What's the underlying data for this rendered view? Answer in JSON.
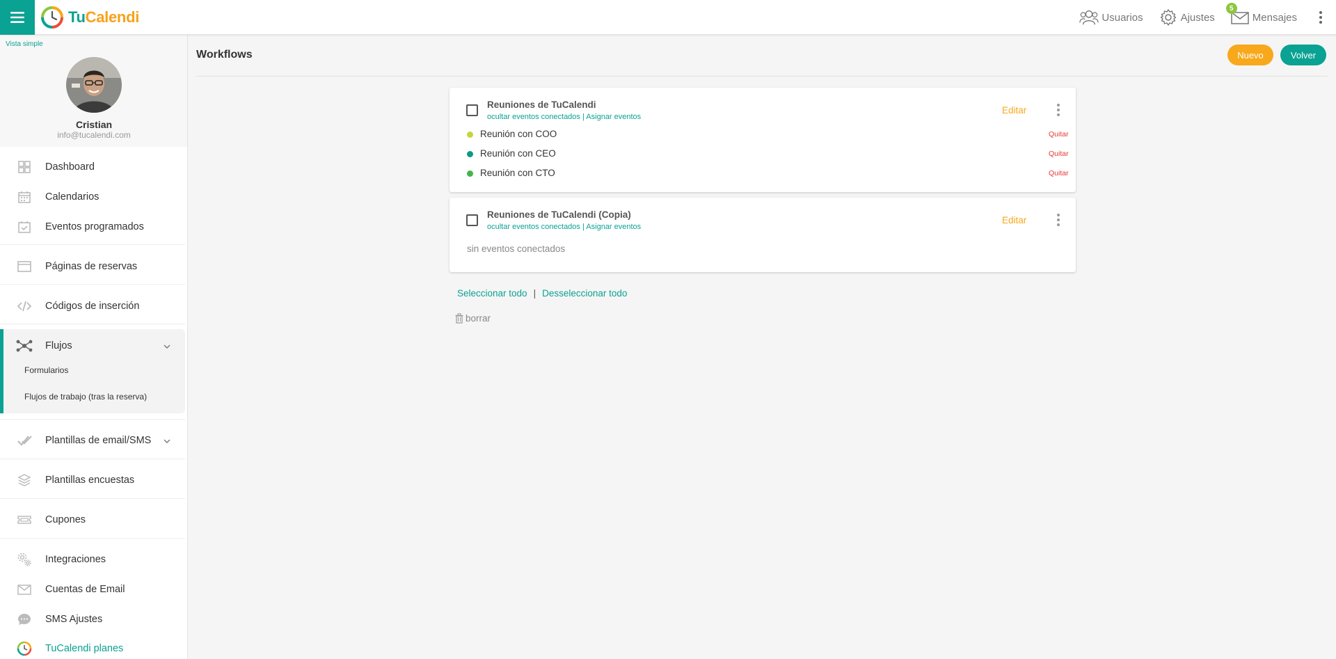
{
  "topbar": {
    "logo_tu": "Tu",
    "logo_cal": "Calendi",
    "usuarios": "Usuarios",
    "ajustes": "Ajustes",
    "mensajes": "Mensajes",
    "mensajes_badge": "5"
  },
  "sidebar": {
    "vista": "Vista simple",
    "profile": {
      "name": "Cristian",
      "email": "info@tucalendi.com"
    },
    "items": {
      "dashboard": "Dashboard",
      "calendarios": "Calendarios",
      "eventos": "Eventos programados",
      "paginas": "Páginas de reservas",
      "codigos": "Códigos de inserción",
      "flujos": "Flujos",
      "formularios": "Formularios",
      "flujos_trabajo": "Flujos de trabajo (tras la reserva)",
      "plantillas_email": "Plantillas de email/SMS",
      "plantillas_encuestas": "Plantillas encuestas",
      "cupones": "Cupones",
      "integraciones": "Integraciones",
      "cuentas_email": "Cuentas de Email",
      "sms_ajustes": "SMS Ajustes",
      "planes": "TuCalendi planes"
    }
  },
  "main": {
    "title": "Workflows",
    "btn_nuevo": "Nuevo",
    "btn_volver": "Volver",
    "workflows": [
      {
        "title": "Reuniones de TuCalendi",
        "link_hide": "ocultar eventos conectados",
        "link_sep": "|",
        "link_assign": "Asignar eventos",
        "edit": "Editar",
        "events": [
          {
            "name": "Reunión con COO",
            "color": "#c6d63a",
            "remove": "Quitar"
          },
          {
            "name": "Reunión con CEO",
            "color": "#0a9a86",
            "remove": "Quitar"
          },
          {
            "name": "Reunión con CTO",
            "color": "#43b549",
            "remove": "Quitar"
          }
        ]
      },
      {
        "title": "Reuniones de TuCalendi (Copia)",
        "link_hide": "ocultar eventos conectados",
        "link_sep": "|",
        "link_assign": "Asignar eventos",
        "edit": "Editar",
        "empty": "sin eventos conectados"
      }
    ],
    "select_all": "Seleccionar todo",
    "select_sep": "|",
    "deselect_all": "Desseleccionar todo",
    "delete": "borrar"
  },
  "colors": {
    "primary": "#0aa292",
    "accent": "#f7a81b",
    "danger": "#e53935"
  }
}
